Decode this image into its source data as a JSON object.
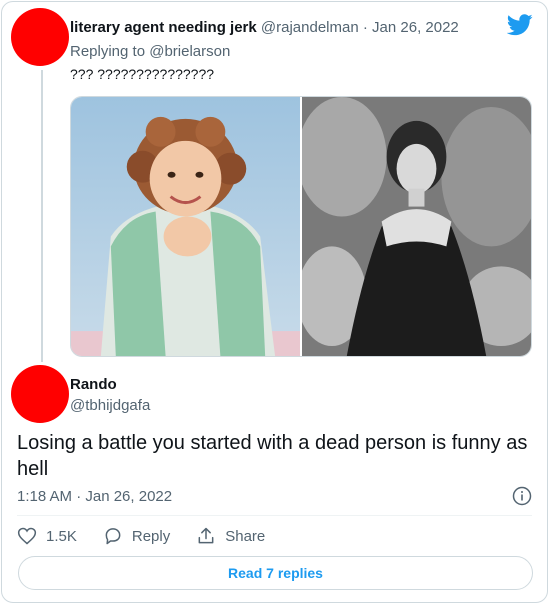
{
  "parent_tweet": {
    "display_name": "literary agent needing jerk",
    "handle": "@rajandelman",
    "separator": "·",
    "date": "Jan 26, 2022",
    "replying_prefix": "Replying to",
    "replying_to": "@brielarson",
    "text": "??? ???????????????"
  },
  "main_tweet": {
    "display_name": "Rando",
    "handle": "@tbhijdgafa",
    "text": "Losing a battle you started with a dead person is funny as hell",
    "timestamp": "1:18 AM · Jan 26, 2022"
  },
  "actions": {
    "like_count": "1.5K",
    "reply_label": "Reply",
    "share_label": "Share"
  },
  "read_replies_label": "Read 7 replies",
  "icons": {
    "logo": "twitter-bird-icon",
    "info": "info-icon",
    "like": "heart-icon",
    "reply": "speech-bubble-icon",
    "share": "share-icon"
  },
  "colors": {
    "brand_blue": "#1d9bf0",
    "avatar_red": "#ff0000",
    "muted_text": "#536471",
    "border": "#cfd9de"
  }
}
